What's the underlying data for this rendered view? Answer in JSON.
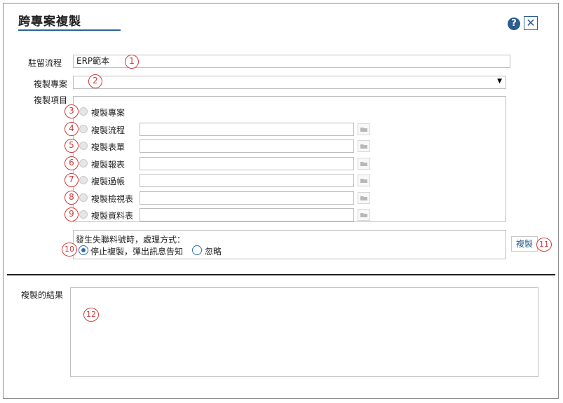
{
  "dialog": {
    "title": "跨專案複製",
    "help_glyph": "?",
    "close_glyph": "✕"
  },
  "form": {
    "flow_label": "駐留流程",
    "flow_value": "ERP範本",
    "project_label": "複製專案",
    "project_value": "",
    "items_label": "複製項目",
    "items": [
      {
        "label": "複製專案",
        "badge": "3",
        "has_input": false
      },
      {
        "label": "複製流程",
        "badge": "4",
        "has_input": true
      },
      {
        "label": "複製表單",
        "badge": "5",
        "has_input": true
      },
      {
        "label": "複製報表",
        "badge": "6",
        "has_input": true
      },
      {
        "label": "複製過帳",
        "badge": "7",
        "has_input": true
      },
      {
        "label": "複製檢視表",
        "badge": "8",
        "has_input": true
      },
      {
        "label": "複製資料表",
        "badge": "9",
        "has_input": true
      }
    ],
    "mismatch_prompt": "發生失聯料號時，處理方式：",
    "option_stop": "停止複製，彈出訊息告知",
    "option_ignore": "忽略",
    "copy_button": "複製",
    "result_label": "複製的結果"
  },
  "badges": {
    "b1": "1",
    "b2": "2",
    "b10": "10",
    "b11": "11",
    "b12": "12"
  },
  "colors": {
    "accent": "#2c5d8f",
    "badge": "#d23a3a",
    "radio_selected": "#2c6fb0"
  }
}
